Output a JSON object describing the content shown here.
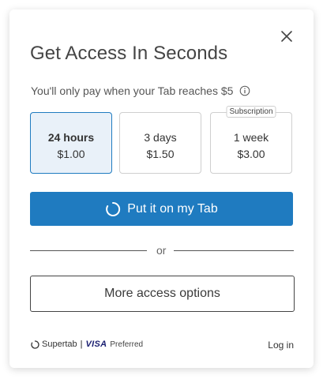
{
  "dialog": {
    "title": "Get Access In Seconds",
    "subtitle": "You'll only pay when your Tab reaches $5"
  },
  "options": [
    {
      "duration": "24 hours",
      "price": "$1.00",
      "selected": true
    },
    {
      "duration": "3 days",
      "price": "$1.50",
      "selected": false
    },
    {
      "duration": "1 week",
      "price": "$3.00",
      "selected": false,
      "badge": "Subscription"
    }
  ],
  "primary_button": {
    "label": "Put it on my Tab"
  },
  "divider": {
    "label": "or"
  },
  "secondary_button": {
    "label": "More access options"
  },
  "footer": {
    "brand": "Supertab",
    "separator": "|",
    "visa": "VISA",
    "preferred": "Preferred",
    "login": "Log in"
  },
  "colors": {
    "accent": "#1f7bc0",
    "selected_bg": "#e9f1f9"
  },
  "icons": {
    "close": "close-icon",
    "info": "info-icon",
    "spinner": "spinner-icon",
    "brand": "supertab-logo-icon"
  }
}
